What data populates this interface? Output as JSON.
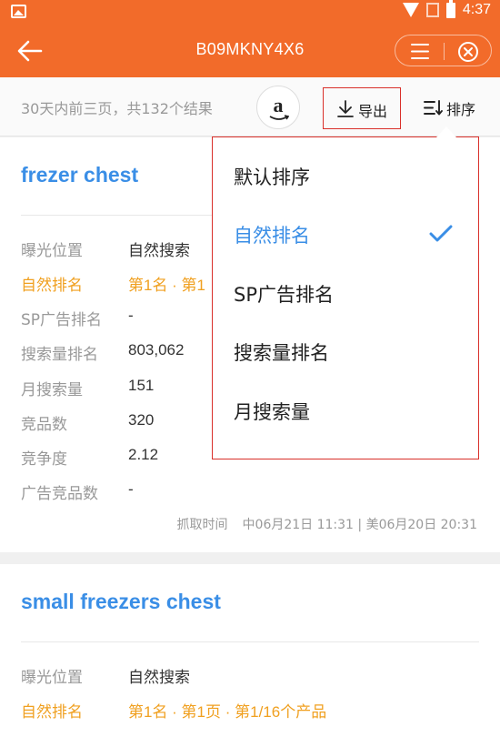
{
  "status_bar": {
    "time": "4:37"
  },
  "header": {
    "title": "B09MKNY4X6"
  },
  "toolbar": {
    "summary": "30天内前三页，共132个结果",
    "amazon_letter": "a",
    "export_label": "导出",
    "sort_label": "排序"
  },
  "sort_menu": {
    "options": [
      "默认排序",
      "自然排名",
      "SP广告排名",
      "搜索量排名",
      "月搜索量"
    ],
    "selected": "自然排名"
  },
  "cards": [
    {
      "keyword": "frezer chest",
      "rows": [
        {
          "label": "曝光位置",
          "value": "自然搜索"
        },
        {
          "label": "自然排名",
          "value": "第1名 · 第1"
        },
        {
          "label": "SP广告排名",
          "value": "-"
        },
        {
          "label": "搜索量排名",
          "value": "803,062"
        },
        {
          "label": "月搜索量",
          "value": "151"
        },
        {
          "label": "竞品数",
          "value": "320"
        },
        {
          "label": "竞争度",
          "value": "2.12"
        },
        {
          "label": "广告竞品数",
          "value": "-"
        }
      ],
      "fetch_label": "抓取时间",
      "fetch_time": "中06月21日 11:31 | 美06月20日 20:31"
    },
    {
      "keyword": "small freezers chest",
      "rows": [
        {
          "label": "曝光位置",
          "value": "自然搜索"
        },
        {
          "label": "自然排名",
          "value": "第1名 · 第1页 · 第1/16个产品"
        }
      ]
    }
  ],
  "colors": {
    "brand_orange": "#f26b2a",
    "link_blue": "#3a8ee6",
    "rank_orange": "#f0a020",
    "highlight_red": "#d9302a"
  }
}
